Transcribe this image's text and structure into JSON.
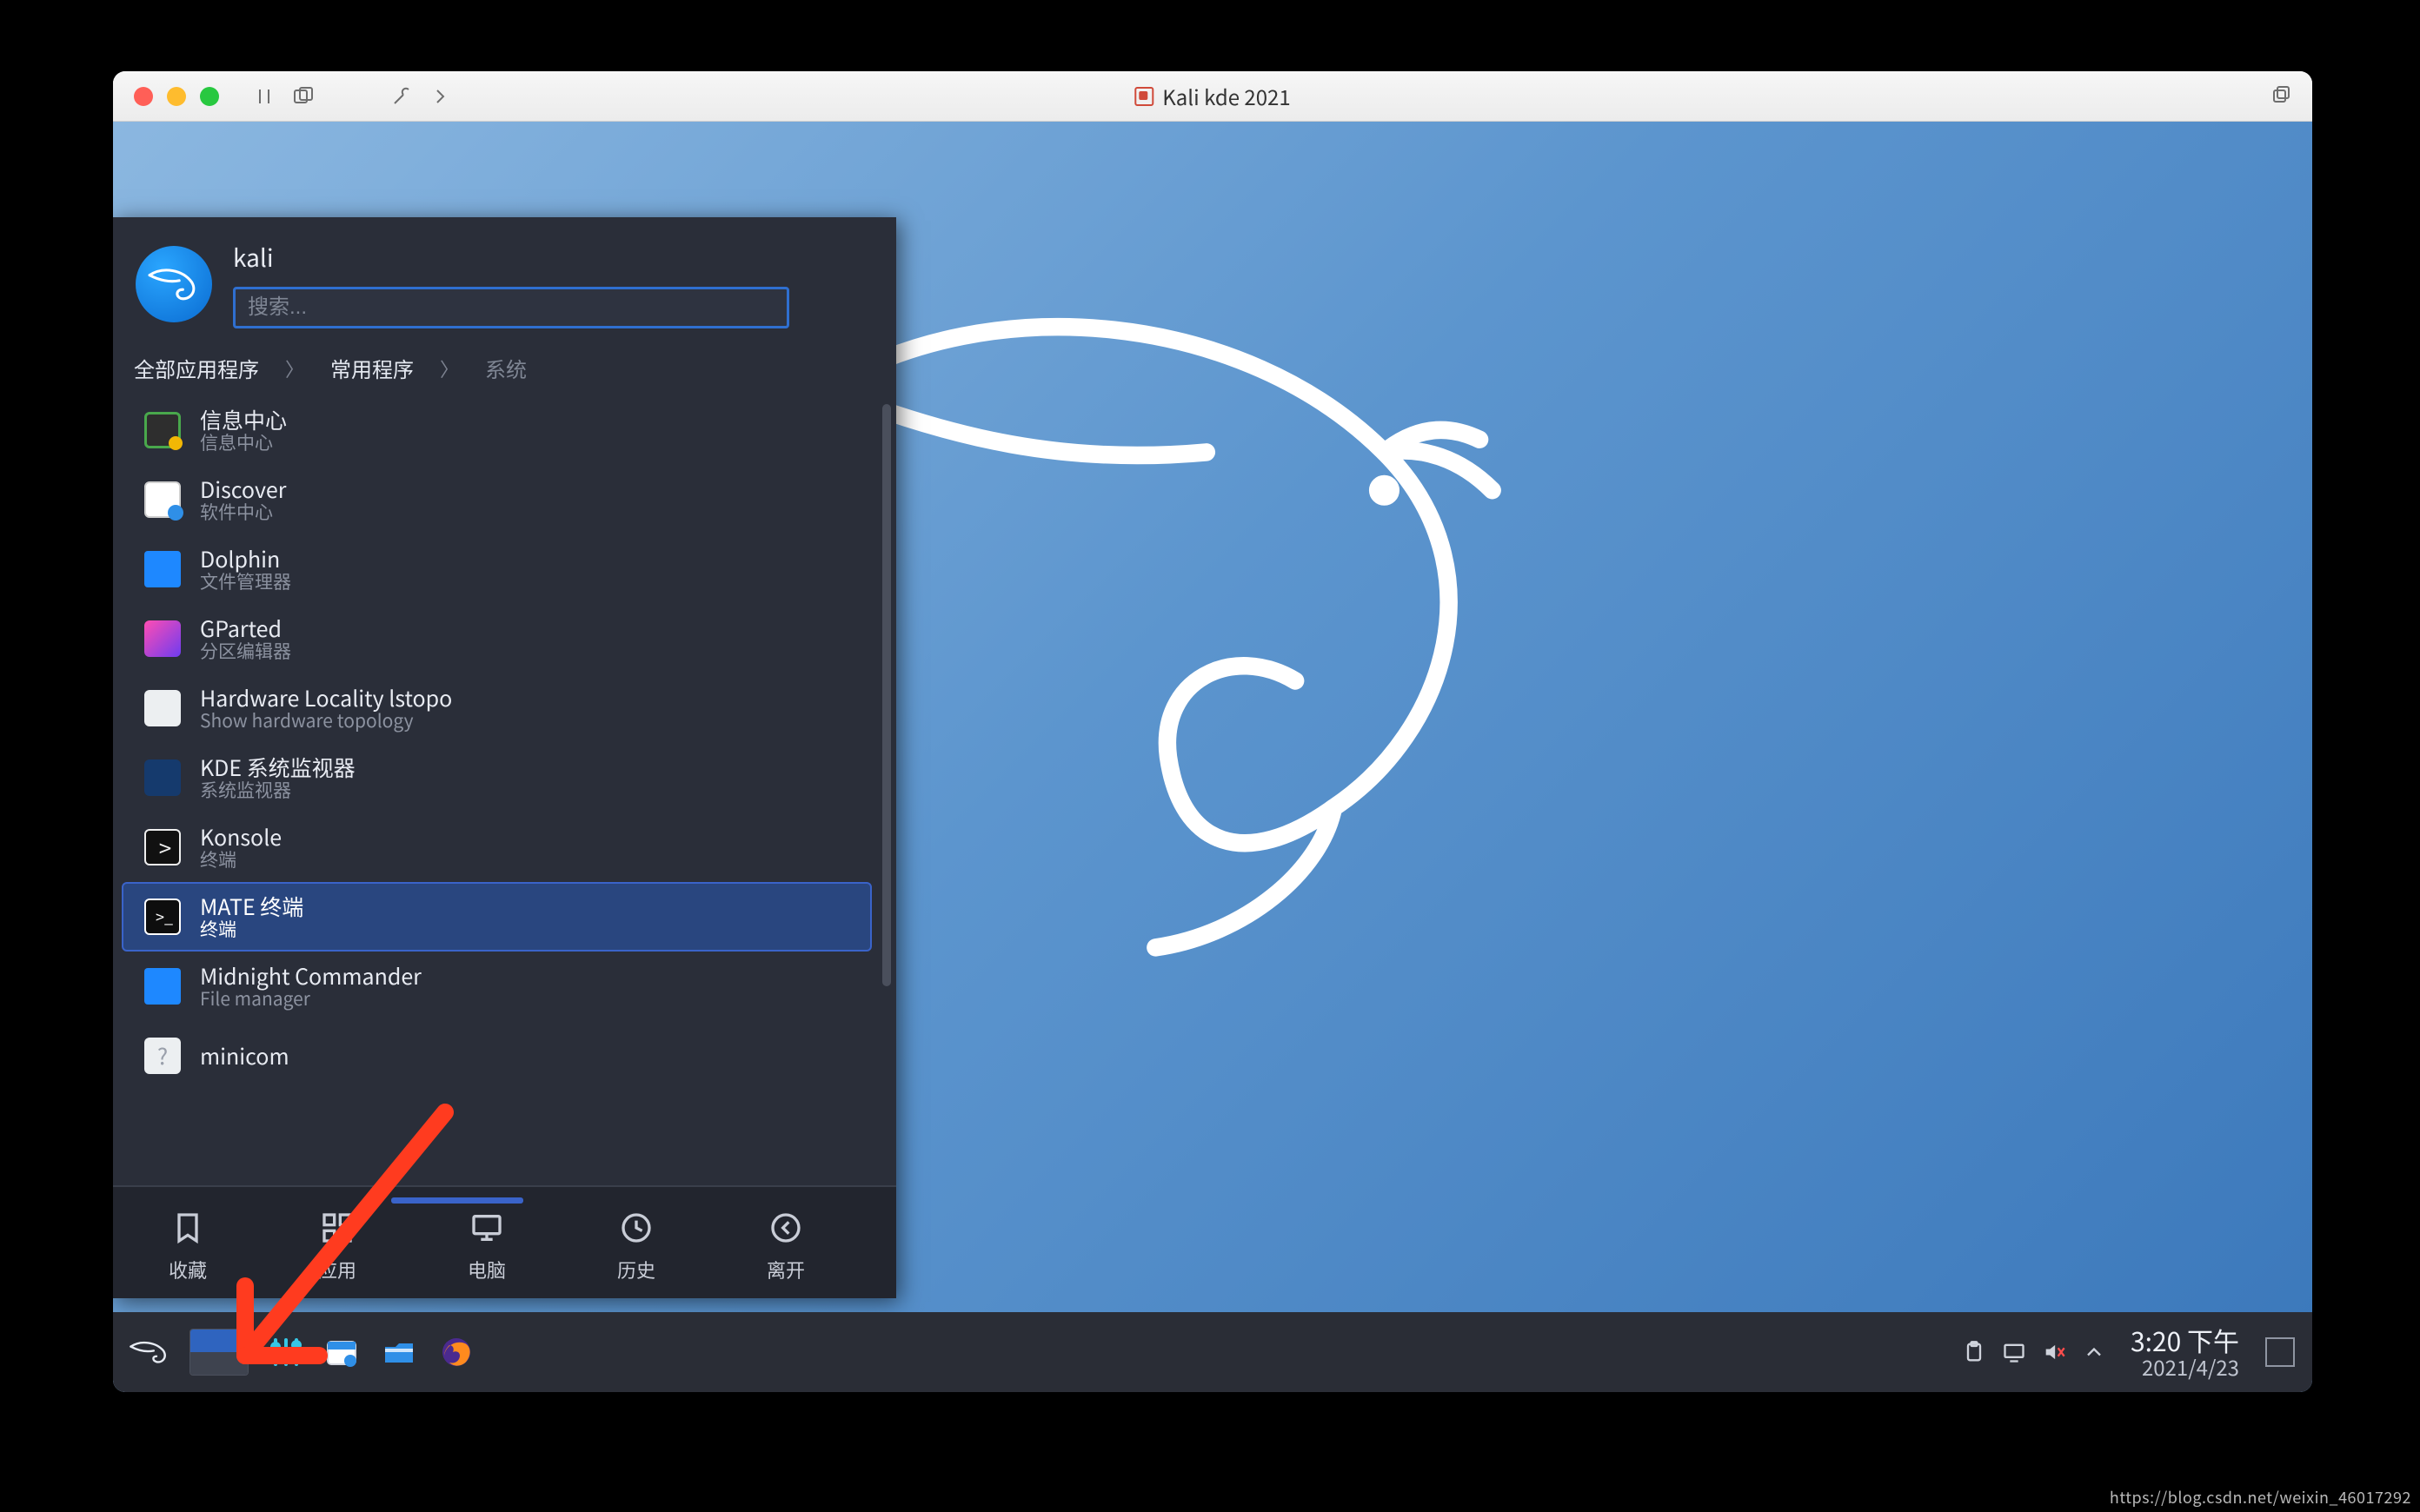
{
  "host": {
    "title": "Kali kde 2021"
  },
  "menu": {
    "username": "kali",
    "search_placeholder": "搜索...",
    "breadcrumb": {
      "all": "全部应用程序",
      "common": "常用程序",
      "system": "系统"
    },
    "apps": [
      {
        "title": "信息中心",
        "sub": "信息中心",
        "icon": "ic-info"
      },
      {
        "title": "Discover",
        "sub": "软件中心",
        "icon": "ic-discover"
      },
      {
        "title": "Dolphin",
        "sub": "文件管理器",
        "icon": "ic-dolphin"
      },
      {
        "title": "GParted",
        "sub": "分区编辑器",
        "icon": "ic-gparted"
      },
      {
        "title": "Hardware Locality lstopo",
        "sub": "Show hardware topology",
        "icon": "ic-hw"
      },
      {
        "title": "KDE 系统监视器",
        "sub": "系统监视器",
        "icon": "ic-kde"
      },
      {
        "title": "Konsole",
        "sub": "终端",
        "icon": "ic-konsole"
      },
      {
        "title": "MATE 终端",
        "sub": "终端",
        "icon": "ic-mate",
        "selected": true
      },
      {
        "title": "Midnight Commander",
        "sub": "File manager",
        "icon": "ic-mc"
      },
      {
        "title": "minicom",
        "sub": "",
        "icon": "ic-unknown"
      }
    ],
    "tabs": {
      "fav": "收藏",
      "apps": "应用",
      "computer": "电脑",
      "history": "历史",
      "leave": "离开"
    }
  },
  "panel": {
    "time": "3:20 下午",
    "date": "2021/4/23"
  },
  "watermark": "https://blog.csdn.net/weixin_46017292"
}
